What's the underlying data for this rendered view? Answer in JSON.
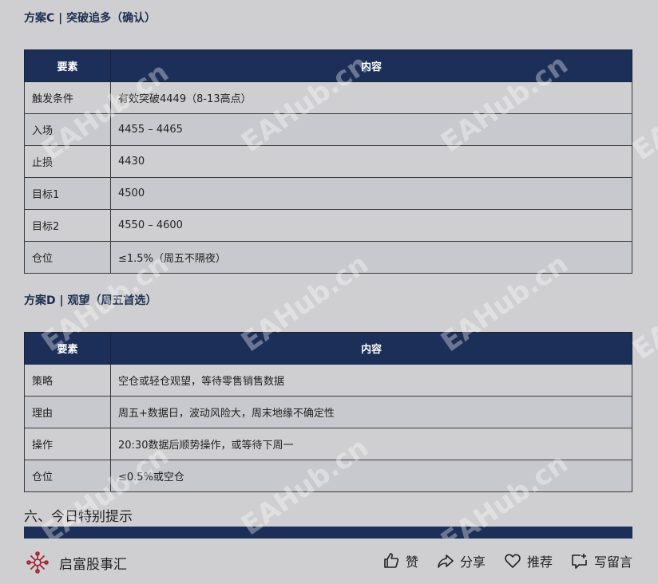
{
  "plan_c": {
    "title": "方案C | 突破追多（确认）",
    "header": [
      "要素",
      "内容"
    ],
    "rows": [
      [
        "触发条件",
        "有效突破4449（8-13高点）"
      ],
      [
        "入场",
        "4455 – 4465"
      ],
      [
        "止损",
        "4430"
      ],
      [
        "目标1",
        "4500"
      ],
      [
        "目标2",
        "4550 – 4600"
      ],
      [
        "仓位",
        "≤1.5%（周五不隔夜）"
      ]
    ]
  },
  "plan_d": {
    "title": "方案D | 观望（周五首选）",
    "header": [
      "要素",
      "内容"
    ],
    "rows": [
      [
        "策略",
        "空仓或轻仓观望，等待零售销售数据"
      ],
      [
        "理由",
        "周五+数据日，波动风险大，周末地缘不确定性"
      ],
      [
        "操作",
        "20:30数据后顺势操作，或等待下周一"
      ],
      [
        "仓位",
        "≤0.5%或空仓"
      ]
    ]
  },
  "section_six": {
    "heading": "六、今日特别提示"
  },
  "watermark": "EAHub.cn",
  "footer": {
    "brand_name": "启富股事汇",
    "like_label": "赞",
    "share_label": "分享",
    "recommend_label": "推荐",
    "comment_label": "写留言"
  },
  "colors": {
    "header_bg": "#1c2f58",
    "title_color": "#1b2d52",
    "page_bg": "#cfcfd1",
    "logo_red": "#a11f2c"
  }
}
